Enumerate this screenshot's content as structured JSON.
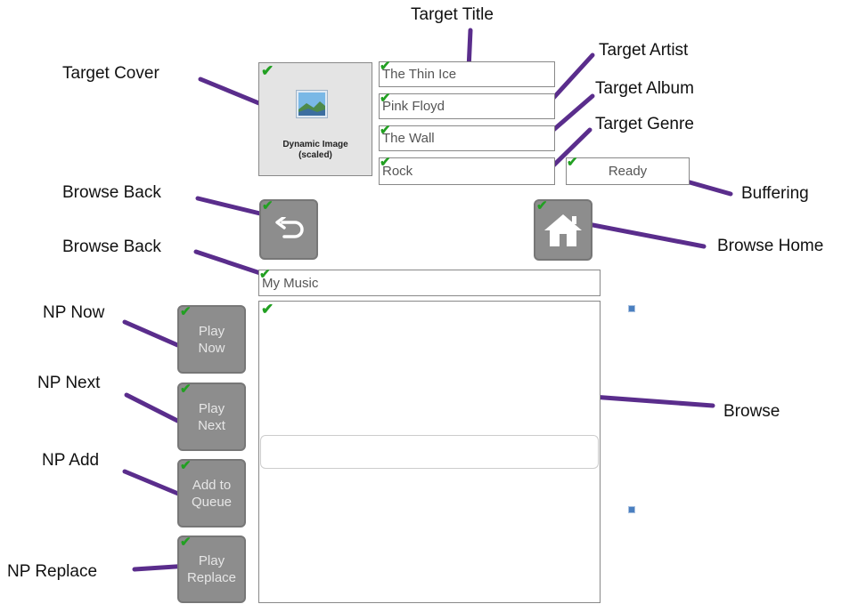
{
  "callouts": {
    "target_title": "Target Title",
    "target_artist": "Target Artist",
    "target_album": "Target Album",
    "target_genre": "Target Genre",
    "target_cover": "Target Cover",
    "browse_back_1": "Browse Back",
    "browse_back_2": "Browse Back",
    "buffering": "Buffering",
    "browse_home": "Browse Home",
    "np_now": "NP Now",
    "np_next": "NP Next",
    "np_add": "NP Add",
    "np_replace": "NP Replace",
    "browse": "Browse"
  },
  "cover": {
    "caption_line1": "Dynamic Image",
    "caption_line2": "(scaled)"
  },
  "fields": {
    "title": "The Thin Ice",
    "artist": "Pink Floyd",
    "album": "The Wall",
    "genre": "Rock",
    "status": "Ready",
    "path": "My Music"
  },
  "buttons": {
    "play_now": [
      "Play",
      "Now"
    ],
    "play_next": [
      "Play",
      "Next"
    ],
    "add_queue": [
      "Add to",
      "Queue"
    ],
    "play_replace": [
      "Play",
      "Replace"
    ]
  },
  "icons": {
    "check": "checkmark-icon",
    "back": "back-arrow-icon",
    "home": "home-icon",
    "image": "image-placeholder-icon"
  },
  "colors": {
    "check": "#22a022",
    "button": "#8d8d8d",
    "callout_line": "#5a2d8c"
  }
}
